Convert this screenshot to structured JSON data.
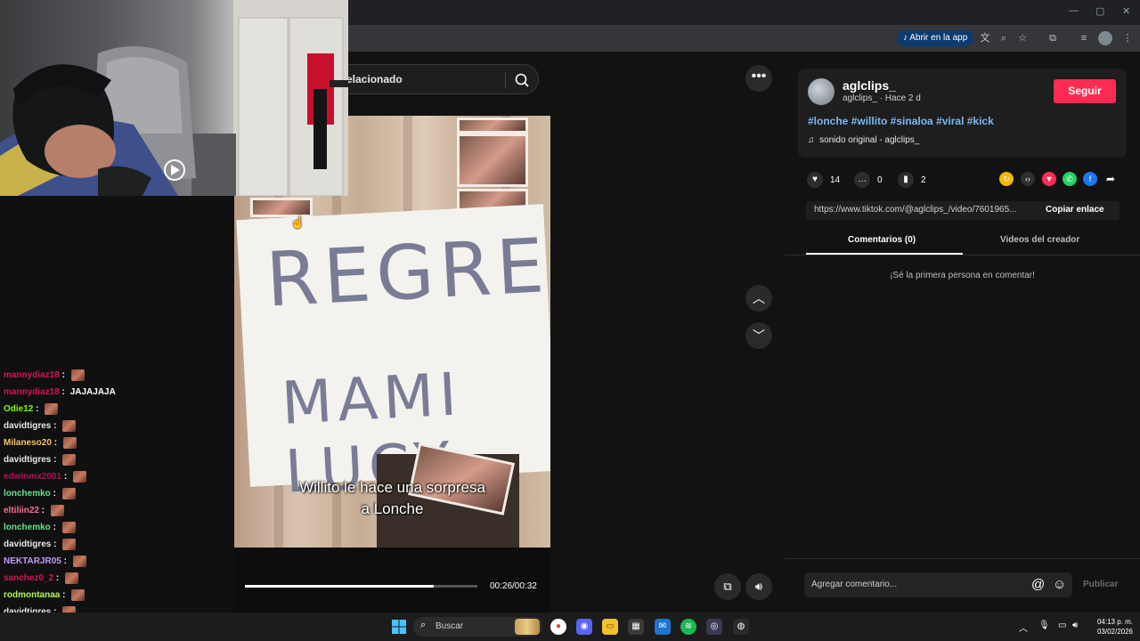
{
  "browser": {
    "open_in_app_label": "Abrir en la app"
  },
  "search": {
    "text": "elacionado"
  },
  "video": {
    "caption_line1": "Willito le hace una sorpresa",
    "caption_line2": "a Lonche",
    "sign_line1": "REGRESA",
    "sign_line2": "MAMI LUCY",
    "time": "00:26/00:32",
    "progress_fraction": 0.8125
  },
  "chat": {
    "messages": [
      {
        "user": "mannydiaz18",
        "color": "#d4145a",
        "text": "",
        "emote": true
      },
      {
        "user": "mannydiaz18",
        "color": "#d4145a",
        "text": "JAJAJAJA",
        "emote": false
      },
      {
        "user": "Odie12",
        "color": "#7cfc00",
        "text": "",
        "emote": true
      },
      {
        "user": "davidtigres",
        "color": "#e8e8e8",
        "text": "",
        "emote": true
      },
      {
        "user": "Milaneso20",
        "color": "#f0c36b",
        "text": "",
        "emote": true
      },
      {
        "user": "davidtigres",
        "color": "#e8e8e8",
        "text": "",
        "emote": true
      },
      {
        "user": "edwinmx2001",
        "color": "#b0105a",
        "text": "",
        "emote": true
      },
      {
        "user": "lonchemko",
        "color": "#66e08f",
        "text": "",
        "emote": true
      },
      {
        "user": "eltiliin22",
        "color": "#ff6f91",
        "text": "",
        "emote": true
      },
      {
        "user": "lonchemko",
        "color": "#66e08f",
        "text": "",
        "emote": true
      },
      {
        "user": "davidtigres",
        "color": "#e8e8e8",
        "text": "",
        "emote": true
      },
      {
        "user": "NEKTARJR05",
        "color": "#c39bff",
        "text": "",
        "emote": true
      },
      {
        "user": "sanchez0_2",
        "color": "#d4145a",
        "text": "",
        "emote": true
      },
      {
        "user": "rodmontanaa",
        "color": "#b6f25a",
        "text": "",
        "emote": true
      },
      {
        "user": "davidtigres",
        "color": "#e8e8e8",
        "text": "",
        "emote": true
      },
      {
        "user": "lonchemko",
        "color": "#66e08f",
        "text": "",
        "emote": true
      }
    ]
  },
  "author": {
    "username": "aglclips_",
    "subline": "aglclips_ · Hace 2 d",
    "follow_label": "Seguir",
    "hashtags": "#lonche #willito #sinaloa #viral #kick",
    "sound": "sonido original - aglclips_"
  },
  "stats": {
    "likes": "14",
    "comments": "0",
    "saves": "2"
  },
  "link": {
    "url": "https://www.tiktok.com/@aglclips_/video/7601965...",
    "copy_label": "Copiar enlace"
  },
  "tabs": {
    "comments": "Comentarios (0)",
    "creator_videos": "Videos del creador"
  },
  "comments": {
    "empty_message": "¡Sé la primera persona en comentar!",
    "placeholder": "Agregar comentario...",
    "publish_label": "Publicar"
  },
  "taskbar": {
    "search_label": "Buscar",
    "time": "04:13 p. m.",
    "date": "03/02/2026"
  },
  "colors": {
    "accent": "#fe2c55",
    "hashtag": "#7cb8f0"
  }
}
